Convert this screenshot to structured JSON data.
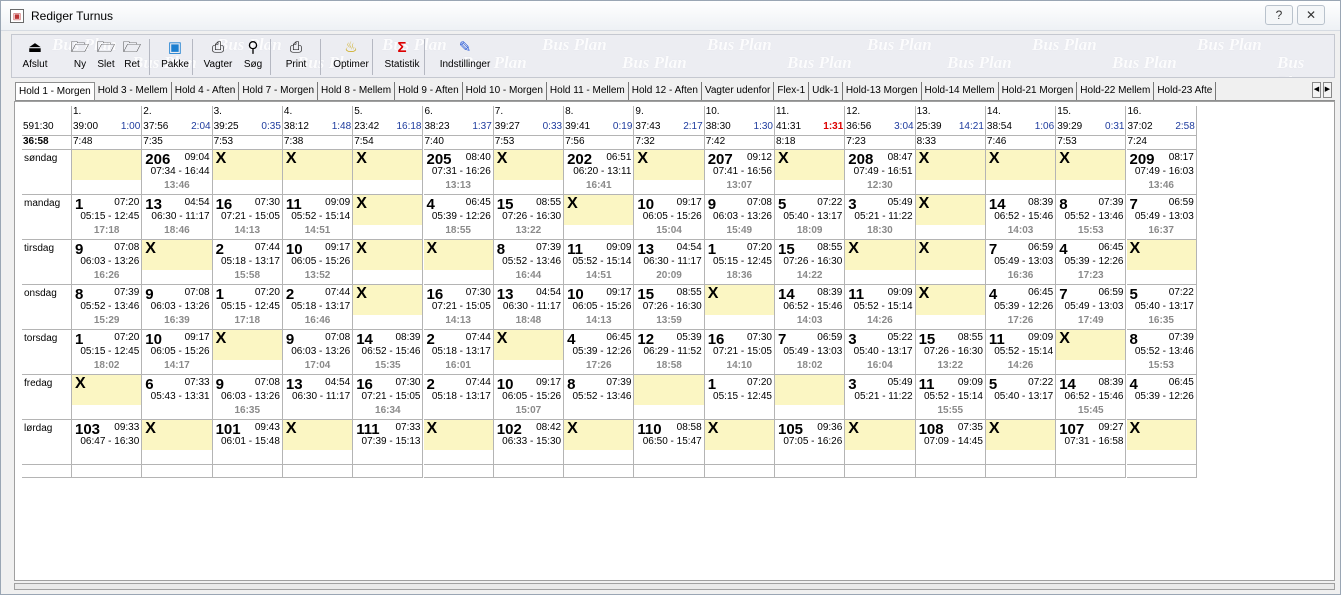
{
  "window": {
    "title": "Rediger Turnus",
    "help_btn": "?",
    "close_btn": "✕"
  },
  "toolbar": {
    "watermark": "Bus Plan",
    "buttons": [
      {
        "label": "Afslut",
        "icon": "exit-icon",
        "glyph": "⏏"
      },
      {
        "label": "Ny",
        "icon": "new-folder-icon",
        "glyph": "🗁"
      },
      {
        "label": "Slet",
        "icon": "delete-folder-icon",
        "glyph": "🗁"
      },
      {
        "label": "Ret",
        "icon": "edit-folder-icon",
        "glyph": "🗁"
      },
      {
        "label": "Pakke",
        "icon": "package-icon",
        "glyph": "▣"
      },
      {
        "label": "Vagter",
        "icon": "shifts-icon",
        "glyph": "⎙"
      },
      {
        "label": "Søg",
        "icon": "binoculars-icon",
        "glyph": "⚲"
      },
      {
        "label": "Print",
        "icon": "printer-icon",
        "glyph": "⎙"
      },
      {
        "label": "Optimer",
        "icon": "genie-lamp-icon",
        "glyph": "♨"
      },
      {
        "label": "Statistik",
        "icon": "sigma-icon",
        "glyph": "Σ"
      },
      {
        "label": "Indstillinger",
        "icon": "settings-icon",
        "glyph": "✎"
      }
    ]
  },
  "tabs": [
    "Hold 1 - Morgen",
    "Hold 3 - Mellem",
    "Hold 4 - Aften",
    "Hold 7 - Morgen",
    "Hold 8 - Mellem",
    "Hold 9 - Aften",
    "Hold 10 - Morgen",
    "Hold 11 - Mellem",
    "Hold 12 - Aften",
    "Vagter udenfor",
    "Flex-1",
    "Udk-1",
    "Hold-13 Morgen",
    "Hold-14 Mellem",
    "Hold-21 Morgen",
    "Hold-22 Mellem",
    "Hold-23 Afte"
  ],
  "tab_scroll": {
    "left": "◀",
    "right": "▶"
  },
  "summary": {
    "total_line": "591:30",
    "avg_line": "36:58"
  },
  "weeks": [
    {
      "week": "1.",
      "total": "39:00",
      "diff": "1:00",
      "avg": "7:48"
    },
    {
      "week": "2.",
      "total": "37:56",
      "diff": "2:04",
      "avg": "7:35"
    },
    {
      "week": "3.",
      "total": "39:25",
      "diff": "0:35",
      "avg": "7:53"
    },
    {
      "week": "4.",
      "total": "38:12",
      "diff": "1:48",
      "avg": "7:38"
    },
    {
      "week": "5.",
      "total": "23:42",
      "diff": "16:18",
      "avg": "7:54"
    },
    {
      "week": "6.",
      "total": "38:23",
      "diff": "1:37",
      "avg": "7:40"
    },
    {
      "week": "7.",
      "total": "39:27",
      "diff": "0:33",
      "avg": "7:53"
    },
    {
      "week": "8.",
      "total": "39:41",
      "diff": "0:19",
      "avg": "7:56"
    },
    {
      "week": "9.",
      "total": "37:43",
      "diff": "2:17",
      "avg": "7:32"
    },
    {
      "week": "10.",
      "total": "38:30",
      "diff": "1:30",
      "avg": "7:42"
    },
    {
      "week": "11.",
      "total": "41:31",
      "diff": "1:31",
      "avg": "8:18",
      "diff_red": true
    },
    {
      "week": "12.",
      "total": "36:56",
      "diff": "3:04",
      "avg": "7:23"
    },
    {
      "week": "13.",
      "total": "25:39",
      "diff": "14:21",
      "avg": "8:33"
    },
    {
      "week": "14.",
      "total": "38:54",
      "diff": "1:06",
      "avg": "7:46"
    },
    {
      "week": "15.",
      "total": "39:29",
      "diff": "0:31",
      "avg": "7:53"
    },
    {
      "week": "16.",
      "total": "37:02",
      "diff": "2:58",
      "avg": "7:24"
    }
  ],
  "days": [
    {
      "label": "søndag",
      "cells": [
        {
          "k": "y"
        },
        {
          "k": "s",
          "n": "206",
          "t": "09:04",
          "r": "07:34 - 16:44",
          "tot": "13:46"
        },
        {
          "k": "x"
        },
        {
          "k": "x"
        },
        {
          "k": "x"
        },
        {
          "k": "s",
          "n": "205",
          "t": "08:40",
          "r": "07:31 - 16:26",
          "tot": "13:13"
        },
        {
          "k": "x"
        },
        {
          "k": "s",
          "n": "202",
          "t": "06:51",
          "r": "06:20 - 13:11",
          "tot": "16:41"
        },
        {
          "k": "x"
        },
        {
          "k": "s",
          "n": "207",
          "t": "09:12",
          "r": "07:41 - 16:56",
          "tot": "13:07"
        },
        {
          "k": "x"
        },
        {
          "k": "s",
          "n": "208",
          "t": "08:47",
          "r": "07:49 - 16:51",
          "tot": "12:30"
        },
        {
          "k": "x"
        },
        {
          "k": "x"
        },
        {
          "k": "x"
        },
        {
          "k": "s",
          "n": "209",
          "t": "08:17",
          "r": "07:49 - 16:03",
          "tot": "13:46"
        }
      ]
    },
    {
      "label": "mandag",
      "cells": [
        {
          "k": "s",
          "n": "1",
          "t": "07:20",
          "r": "05:15 - 12:45",
          "tot": "17:18"
        },
        {
          "k": "s",
          "n": "13",
          "t": "04:54",
          "r": "06:30 - 11:17",
          "tot": "18:46"
        },
        {
          "k": "s",
          "n": "16",
          "t": "07:30",
          "r": "07:21 - 15:05",
          "tot": "14:13"
        },
        {
          "k": "s",
          "n": "11",
          "t": "09:09",
          "r": "05:52 - 15:14",
          "tot": "14:51"
        },
        {
          "k": "x"
        },
        {
          "k": "s",
          "n": "4",
          "t": "06:45",
          "r": "05:39 - 12:26",
          "tot": "18:55"
        },
        {
          "k": "s",
          "n": "15",
          "t": "08:55",
          "r": "07:26 - 16:30",
          "tot": "13:22"
        },
        {
          "k": "x"
        },
        {
          "k": "s",
          "n": "10",
          "t": "09:17",
          "r": "06:05 - 15:26",
          "tot": "15:04"
        },
        {
          "k": "s",
          "n": "9",
          "t": "07:08",
          "r": "06:03 - 13:26",
          "tot": "15:49"
        },
        {
          "k": "s",
          "n": "5",
          "t": "07:22",
          "r": "05:40 - 13:17",
          "tot": "18:09"
        },
        {
          "k": "s",
          "n": "3",
          "t": "05:49",
          "r": "05:21 - 11:22",
          "tot": "18:30"
        },
        {
          "k": "x"
        },
        {
          "k": "s",
          "n": "14",
          "t": "08:39",
          "r": "06:52 - 15:46",
          "tot": "14:03"
        },
        {
          "k": "s",
          "n": "8",
          "t": "07:39",
          "r": "05:52 - 13:46",
          "tot": "15:53"
        },
        {
          "k": "s",
          "n": "7",
          "t": "06:59",
          "r": "05:49 - 13:03",
          "tot": "16:37"
        }
      ]
    },
    {
      "label": "tirsdag",
      "cells": [
        {
          "k": "s",
          "n": "9",
          "t": "07:08",
          "r": "06:03 - 13:26",
          "tot": "16:26"
        },
        {
          "k": "x"
        },
        {
          "k": "s",
          "n": "2",
          "t": "07:44",
          "r": "05:18 - 13:17",
          "tot": "15:58"
        },
        {
          "k": "s",
          "n": "10",
          "t": "09:17",
          "r": "06:05 - 15:26",
          "tot": "13:52"
        },
        {
          "k": "x"
        },
        {
          "k": "x"
        },
        {
          "k": "s",
          "n": "8",
          "t": "07:39",
          "r": "05:52 - 13:46",
          "tot": "16:44"
        },
        {
          "k": "s",
          "n": "11",
          "t": "09:09",
          "r": "05:52 - 15:14",
          "tot": "14:51"
        },
        {
          "k": "s",
          "n": "13",
          "t": "04:54",
          "r": "06:30 - 11:17",
          "tot": "20:09"
        },
        {
          "k": "s",
          "n": "1",
          "t": "07:20",
          "r": "05:15 - 12:45",
          "tot": "18:36"
        },
        {
          "k": "s",
          "n": "15",
          "t": "08:55",
          "r": "07:26 - 16:30",
          "tot": "14:22"
        },
        {
          "k": "x"
        },
        {
          "k": "x"
        },
        {
          "k": "s",
          "n": "7",
          "t": "06:59",
          "r": "05:49 - 13:03",
          "tot": "16:36"
        },
        {
          "k": "s",
          "n": "4",
          "t": "06:45",
          "r": "05:39 - 12:26",
          "tot": "17:23"
        },
        {
          "k": "x"
        }
      ]
    },
    {
      "label": "onsdag",
      "cells": [
        {
          "k": "s",
          "n": "8",
          "t": "07:39",
          "r": "05:52 - 13:46",
          "tot": "15:29"
        },
        {
          "k": "s",
          "n": "9",
          "t": "07:08",
          "r": "06:03 - 13:26",
          "tot": "16:39"
        },
        {
          "k": "s",
          "n": "1",
          "t": "07:20",
          "r": "05:15 - 12:45",
          "tot": "17:18"
        },
        {
          "k": "s",
          "n": "2",
          "t": "07:44",
          "r": "05:18 - 13:17",
          "tot": "16:46"
        },
        {
          "k": "x"
        },
        {
          "k": "s",
          "n": "16",
          "t": "07:30",
          "r": "07:21 - 15:05",
          "tot": "14:13"
        },
        {
          "k": "s",
          "n": "13",
          "t": "04:54",
          "r": "06:30 - 11:17",
          "tot": "18:48"
        },
        {
          "k": "s",
          "n": "10",
          "t": "09:17",
          "r": "06:05 - 15:26",
          "tot": "14:13"
        },
        {
          "k": "s",
          "n": "15",
          "t": "08:55",
          "r": "07:26 - 16:30",
          "tot": "13:59"
        },
        {
          "k": "x"
        },
        {
          "k": "s",
          "n": "14",
          "t": "08:39",
          "r": "06:52 - 15:46",
          "tot": "14:03"
        },
        {
          "k": "s",
          "n": "11",
          "t": "09:09",
          "r": "05:52 - 15:14",
          "tot": "14:26"
        },
        {
          "k": "x"
        },
        {
          "k": "s",
          "n": "4",
          "t": "06:45",
          "r": "05:39 - 12:26",
          "tot": "17:26"
        },
        {
          "k": "s",
          "n": "7",
          "t": "06:59",
          "r": "05:49 - 13:03",
          "tot": "17:49"
        },
        {
          "k": "s",
          "n": "5",
          "t": "07:22",
          "r": "05:40 - 13:17",
          "tot": "16:35"
        }
      ]
    },
    {
      "label": "torsdag",
      "cells": [
        {
          "k": "s",
          "n": "1",
          "t": "07:20",
          "r": "05:15 - 12:45",
          "tot": "18:02"
        },
        {
          "k": "s",
          "n": "10",
          "t": "09:17",
          "r": "06:05 - 15:26",
          "tot": "14:17"
        },
        {
          "k": "x"
        },
        {
          "k": "s",
          "n": "9",
          "t": "07:08",
          "r": "06:03 - 13:26",
          "tot": "17:04"
        },
        {
          "k": "s",
          "n": "14",
          "t": "08:39",
          "r": "06:52 - 15:46",
          "tot": "15:35"
        },
        {
          "k": "s",
          "n": "2",
          "t": "07:44",
          "r": "05:18 - 13:17",
          "tot": "16:01"
        },
        {
          "k": "x"
        },
        {
          "k": "s",
          "n": "4",
          "t": "06:45",
          "r": "05:39 - 12:26",
          "tot": "17:26"
        },
        {
          "k": "s",
          "n": "12",
          "t": "05:39",
          "r": "06:29 - 11:52",
          "tot": "18:58"
        },
        {
          "k": "s",
          "n": "16",
          "t": "07:30",
          "r": "07:21 - 15:05",
          "tot": "14:10"
        },
        {
          "k": "s",
          "n": "7",
          "t": "06:59",
          "r": "05:49 - 13:03",
          "tot": "18:02"
        },
        {
          "k": "s",
          "n": "3",
          "t": "05:22",
          "r": "05:40 - 13:17",
          "tot": "16:04"
        },
        {
          "k": "s",
          "n": "15",
          "t": "08:55",
          "r": "07:26 - 16:30",
          "tot": "13:22"
        },
        {
          "k": "s",
          "n": "11",
          "t": "09:09",
          "r": "05:52 - 15:14",
          "tot": "14:26"
        },
        {
          "k": "x"
        },
        {
          "k": "s",
          "n": "8",
          "t": "07:39",
          "r": "05:52 - 13:46",
          "tot": "15:53"
        }
      ]
    },
    {
      "label": "fredag",
      "cells": [
        {
          "k": "x"
        },
        {
          "k": "s",
          "n": "6",
          "t": "07:33",
          "r": "05:43 - 13:31",
          "tot": ""
        },
        {
          "k": "s",
          "n": "9",
          "t": "07:08",
          "r": "06:03 - 13:26",
          "tot": "16:35"
        },
        {
          "k": "s",
          "n": "13",
          "t": "04:54",
          "r": "06:30 - 11:17",
          "tot": ""
        },
        {
          "k": "s",
          "n": "16",
          "t": "07:30",
          "r": "07:21 - 15:05",
          "tot": "16:34"
        },
        {
          "k": "s",
          "n": "2",
          "t": "07:44",
          "r": "05:18 - 13:17",
          "tot": ""
        },
        {
          "k": "s",
          "n": "10",
          "t": "09:17",
          "r": "06:05 - 15:26",
          "tot": "15:07"
        },
        {
          "k": "s",
          "n": "8",
          "t": "07:39",
          "r": "05:52 - 13:46",
          "tot": ""
        },
        {
          "k": "y"
        },
        {
          "k": "s",
          "n": "1",
          "t": "07:20",
          "r": "05:15 - 12:45",
          "tot": ""
        },
        {
          "k": "y"
        },
        {
          "k": "s",
          "n": "3",
          "t": "05:49",
          "r": "05:21 - 11:22",
          "tot": ""
        },
        {
          "k": "s",
          "n": "11",
          "t": "09:09",
          "r": "05:52 - 15:14",
          "tot": "15:55"
        },
        {
          "k": "s",
          "n": "5",
          "t": "07:22",
          "r": "05:40 - 13:17",
          "tot": ""
        },
        {
          "k": "s",
          "n": "14",
          "t": "08:39",
          "r": "06:52 - 15:46",
          "tot": "15:45"
        },
        {
          "k": "s",
          "n": "4",
          "t": "06:45",
          "r": "05:39 - 12:26",
          "tot": ""
        }
      ]
    },
    {
      "label": "lørdag",
      "cells": [
        {
          "k": "s",
          "n": "103",
          "t": "09:33",
          "r": "06:47 - 16:30",
          "tot": ""
        },
        {
          "k": "x"
        },
        {
          "k": "s",
          "n": "101",
          "t": "09:43",
          "r": "06:01 - 15:48",
          "tot": ""
        },
        {
          "k": "x"
        },
        {
          "k": "s",
          "n": "111",
          "t": "07:33",
          "r": "07:39 - 15:13",
          "tot": ""
        },
        {
          "k": "x"
        },
        {
          "k": "s",
          "n": "102",
          "t": "08:42",
          "r": "06:33 - 15:30",
          "tot": ""
        },
        {
          "k": "x"
        },
        {
          "k": "s",
          "n": "110",
          "t": "08:58",
          "r": "06:50 - 15:47",
          "tot": ""
        },
        {
          "k": "x"
        },
        {
          "k": "s",
          "n": "105",
          "t": "09:36",
          "r": "07:05 - 16:26",
          "tot": ""
        },
        {
          "k": "x"
        },
        {
          "k": "s",
          "n": "108",
          "t": "07:35",
          "r": "07:09 - 14:45",
          "tot": ""
        },
        {
          "k": "x"
        },
        {
          "k": "s",
          "n": "107",
          "t": "09:27",
          "r": "07:31 - 16:58",
          "tot": ""
        },
        {
          "k": "x"
        }
      ]
    }
  ],
  "off_mark": "X",
  "colors": {
    "off_cell": "#fbf6c3",
    "diff_blue": "#1f3c9e",
    "diff_red": "#dd0000",
    "total_grey": "#8a8a8a"
  }
}
